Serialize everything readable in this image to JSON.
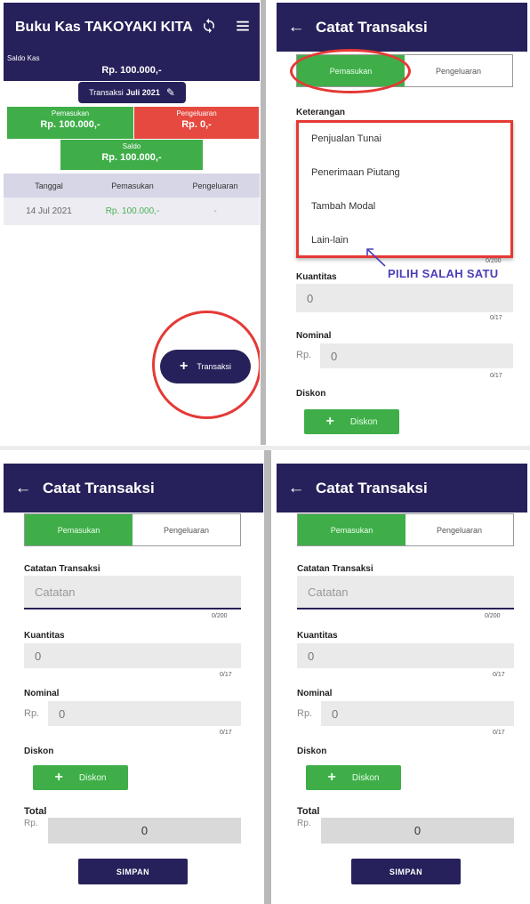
{
  "screen1": {
    "app_title": "Buku Kas TAKOYAKI KITA",
    "icons": [
      "sync-icon",
      "menu-icon"
    ],
    "saldo_label": "Saldo Kas",
    "saldo_value": "Rp. 100.000,-",
    "periode_prefix": "Transaksi",
    "periode_value": "Juli 2021",
    "pemasukan_label": "Pemasukan",
    "pemasukan_value": "Rp. 100.000,-",
    "pengeluaran_label": "Pengeluaran",
    "pengeluaran_value": "Rp. 0,-",
    "saldo_card_label": "Saldo",
    "saldo_card_value": "Rp. 100.000,-",
    "table": {
      "headers": [
        "Tanggal",
        "Pemasukan",
        "Pengeluaran"
      ],
      "rows": [
        [
          "14 Jul 2021",
          "Rp. 100.000,-",
          "-"
        ]
      ]
    },
    "fab_label": "Transaksi"
  },
  "form": {
    "title": "Catat Transaksi",
    "tab_in": "Pemasukan",
    "tab_out": "Pengeluaran",
    "keterangan_label": "Keterangan",
    "catatan_label": "Catatan Transaksi",
    "catatan_placeholder": "Catatan",
    "catatan_counter": "0/200",
    "kuantitas_label": "Kuantitas",
    "kuantitas_value": "0",
    "kuantitas_counter": "0/17",
    "nominal_label": "Nominal",
    "nominal_prefix": "Rp.",
    "nominal_value": "0",
    "nominal_counter": "0/17",
    "diskon_label": "Diskon",
    "diskon_button": "Diskon",
    "total_label": "Total",
    "total_prefix": "Rp.",
    "total_value": "0",
    "save_button": "SIMPAN"
  },
  "dropdown_options": [
    "Penjualan Tunai",
    "Penerimaan Piutang",
    "Tambah Modal",
    "Lain-lain"
  ],
  "annotation": "PILIH SALAH SATU",
  "colors": {
    "primary": "#26215a",
    "income": "#3fae49",
    "expense": "#e5493f",
    "highlight": "#e53935",
    "annotation": "#4a3fb8"
  }
}
